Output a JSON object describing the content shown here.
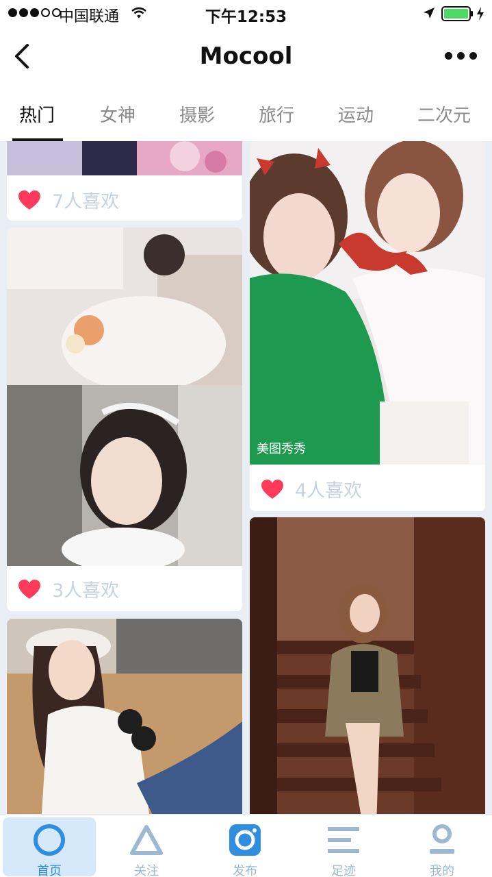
{
  "status_bar": {
    "carrier": "中国联通",
    "time": "下午12:53"
  },
  "nav": {
    "title": "Mocool"
  },
  "tabs": [
    {
      "label": "热门",
      "active": true
    },
    {
      "label": "女神",
      "active": false
    },
    {
      "label": "摄影",
      "active": false
    },
    {
      "label": "旅行",
      "active": false
    },
    {
      "label": "运动",
      "active": false
    },
    {
      "label": "二次元",
      "active": false
    }
  ],
  "feed": {
    "left_column": [
      {
        "likes": "7人喜欢"
      },
      {
        "likes": "3人喜欢"
      },
      {
        "likes": ""
      }
    ],
    "right_column": [
      {
        "likes": "4人喜欢",
        "watermark": "美图秀秀"
      },
      {
        "likes": ""
      }
    ]
  },
  "bottom_tabs": [
    {
      "label": "首页",
      "icon": "home-circle-icon",
      "active": true
    },
    {
      "label": "关注",
      "icon": "triangle-icon",
      "active": false
    },
    {
      "label": "发布",
      "icon": "camera-icon",
      "active": false
    },
    {
      "label": "足迹",
      "icon": "lines-icon",
      "active": false
    },
    {
      "label": "我的",
      "icon": "profile-icon",
      "active": false
    }
  ],
  "colors": {
    "accent": "#2f8ee0",
    "heart": "#ff3b5c",
    "like_text": "#c4d3e4",
    "battery": "#4cd964"
  }
}
